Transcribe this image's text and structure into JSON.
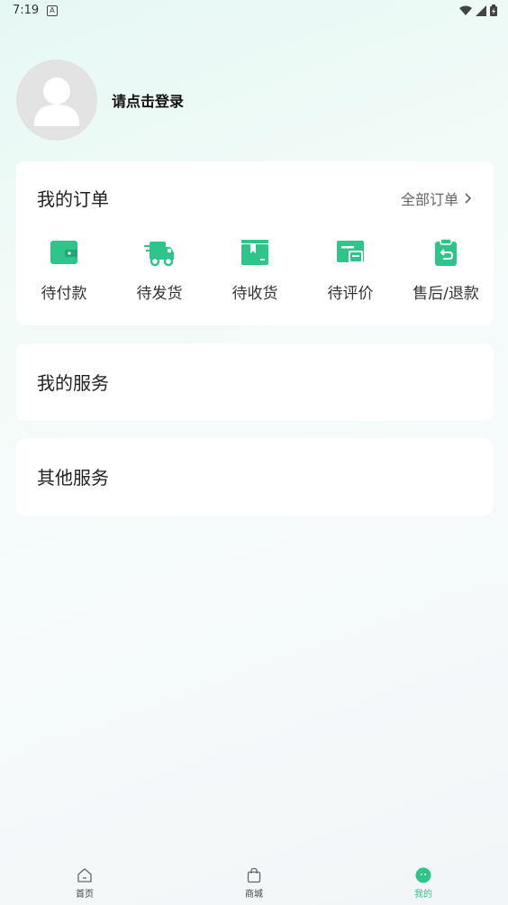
{
  "status_bar": {
    "time": "7:19",
    "a_glyph": "A",
    "icons": [
      "notification-a-icon",
      "wifi-icon",
      "signal-icon",
      "battery-icon"
    ]
  },
  "profile": {
    "login_prompt": "请点击登录",
    "avatar_icon": "user-avatar-icon"
  },
  "orders": {
    "title": "我的订单",
    "all_orders": "全部订单",
    "items": [
      {
        "label": "待付款",
        "icon": "wallet-icon"
      },
      {
        "label": "待发货",
        "icon": "truck-icon"
      },
      {
        "label": "待收货",
        "icon": "box-icon"
      },
      {
        "label": "待评价",
        "icon": "comment-icon"
      },
      {
        "label": "售后/退款",
        "icon": "refund-icon"
      }
    ]
  },
  "my_services": {
    "title": "我的服务"
  },
  "other_services": {
    "title": "其他服务"
  },
  "tabbar": {
    "tabs": [
      {
        "label": "首页",
        "icon": "home-icon"
      },
      {
        "label": "商城",
        "icon": "shopping-bag-icon"
      },
      {
        "label": "我的",
        "icon": "profile-icon"
      }
    ],
    "active_index": 2
  },
  "colors": {
    "accent": "#2ec48a",
    "card_bg": "#ffffff",
    "avatar_bg": "#e3e3e3"
  }
}
